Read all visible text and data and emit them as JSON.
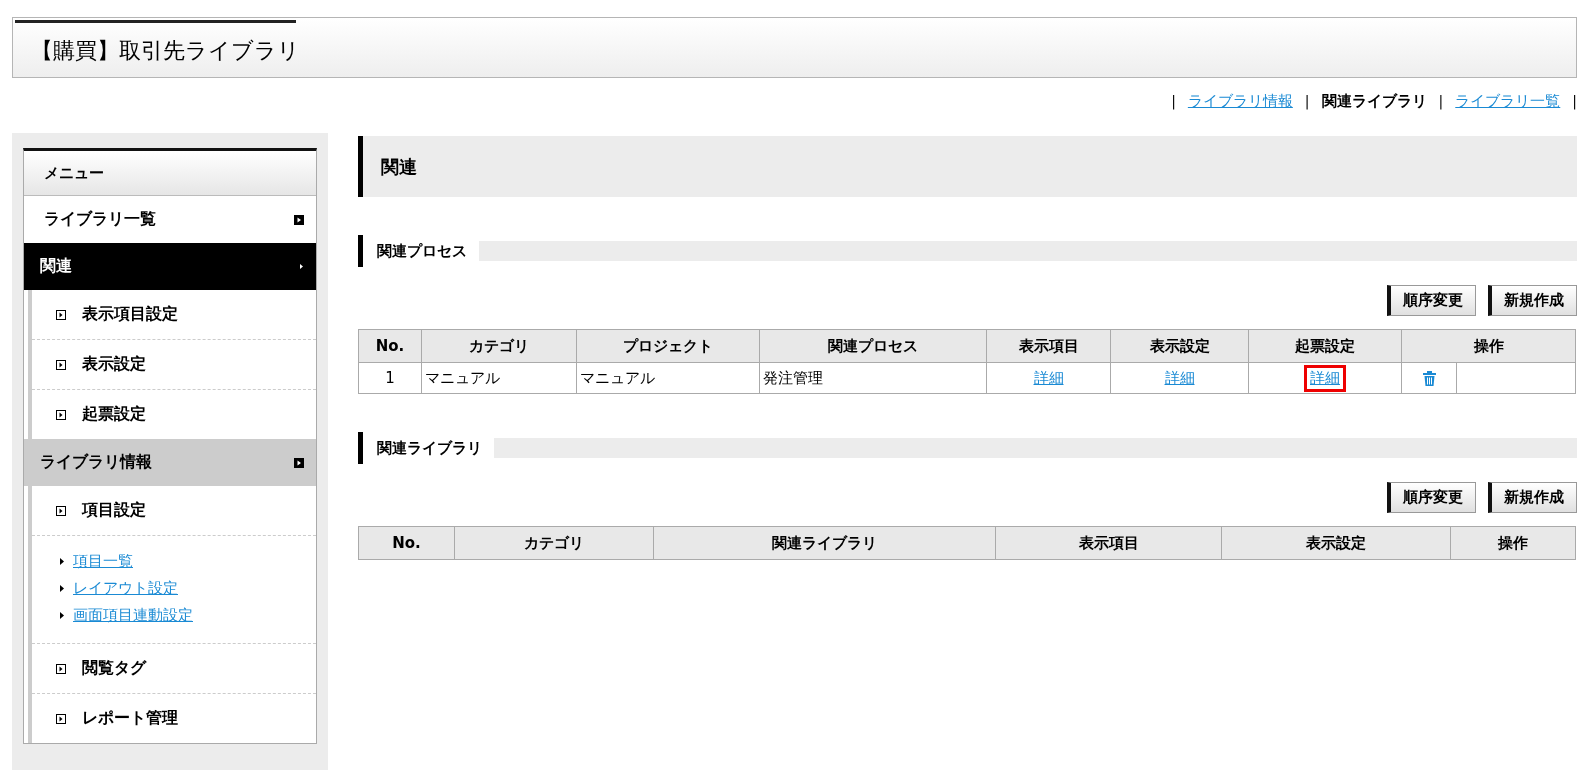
{
  "page_title": "【購買】取引先ライブラリ",
  "top_nav": {
    "separators": [
      "|",
      "|",
      "|",
      "|"
    ],
    "items": [
      {
        "label": "ライブラリ情報",
        "selected": false
      },
      {
        "label": "関連ライブラリ",
        "selected": true
      },
      {
        "label": "ライブラリ一覧",
        "selected": false
      }
    ]
  },
  "sidebar": {
    "title": "メニュー",
    "items": [
      {
        "label": "ライブラリ一覧",
        "selected": false,
        "expanded": false
      },
      {
        "label": "関連",
        "selected": true,
        "expanded": true,
        "children": [
          {
            "kind": "item",
            "label": "表示項目設定"
          },
          {
            "kind": "item",
            "label": "表示設定"
          },
          {
            "kind": "item",
            "label": "起票設定"
          }
        ]
      },
      {
        "label": "ライブラリ情報",
        "selected": false,
        "expanded": true,
        "children": [
          {
            "kind": "item",
            "label": "項目設定"
          },
          {
            "kind": "links",
            "links": [
              "項目一覧",
              "レイアウト設定",
              "画面項目連動設定"
            ]
          },
          {
            "kind": "item",
            "label": "閲覧タグ"
          },
          {
            "kind": "item",
            "label": "レポート管理"
          }
        ]
      }
    ]
  },
  "main": {
    "heading": "関連",
    "sections": [
      {
        "title": "関連プロセス",
        "buttons": [
          "順序変更",
          "新規作成"
        ],
        "columns": [
          "No.",
          "カテゴリ",
          "プロジェクト",
          "関連プロセス",
          "表示項目",
          "表示設定",
          "起票設定",
          "操作"
        ],
        "rows": [
          [
            {
              "kind": "number",
              "text": "1"
            },
            {
              "kind": "text",
              "text": "マニュアル"
            },
            {
              "kind": "text",
              "text": "マニュアル"
            },
            {
              "kind": "text",
              "text": "発注管理"
            },
            {
              "kind": "link",
              "text": "詳細",
              "highlighted": false
            },
            {
              "kind": "link",
              "text": "詳細",
              "highlighted": false
            },
            {
              "kind": "link",
              "text": "詳細",
              "highlighted": true
            },
            {
              "kind": "trash"
            },
            {
              "kind": "empty"
            }
          ]
        ]
      },
      {
        "title": "関連ライブラリ",
        "buttons": [
          "順序変更",
          "新規作成"
        ],
        "columns": [
          "No.",
          "カテゴリ",
          "関連ライブラリ",
          "表示項目",
          "表示設定",
          "操作"
        ]
      }
    ]
  }
}
